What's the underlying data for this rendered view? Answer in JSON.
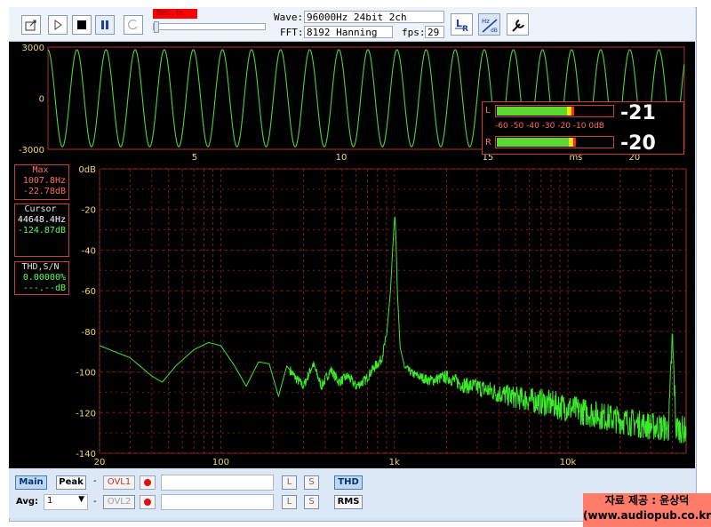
{
  "toolbar": {
    "rec_label": "Rec. In.",
    "wave_label": "Wave:",
    "wave_value": "96000Hz 24bit 2ch",
    "fft_label": "FFT:",
    "fft_value": "8192 Hanning",
    "fps_label": "fps:",
    "fps_value": "29",
    "icons": [
      "export-icon",
      "play-icon",
      "stop-icon",
      "pause-icon",
      "loop-icon",
      "lr-channel-icon",
      "hz-db-icon",
      "settings-wrench-icon"
    ]
  },
  "scope": {
    "y_ticks": [
      "3000",
      "0",
      "-3000"
    ],
    "x_ticks": [
      "5",
      "10",
      "15",
      "20"
    ],
    "x_unit": "ms",
    "waveform": {
      "amplitude": 2850,
      "frequency_hz": 1007.8,
      "duration_ms": 21.7
    },
    "color": "#4cd43a"
  },
  "meters": {
    "left": {
      "channel": "L",
      "value": "-21",
      "level_db": -21
    },
    "right": {
      "channel": "R",
      "value": "-20",
      "level_db": -20
    },
    "scale": "-60 -50 -40 -30 -20 -10 0dB"
  },
  "info": {
    "max_title": "Max",
    "max_freq": "1007.8Hz",
    "max_db": "-22.78dB",
    "cursor_title": "Cursor",
    "cursor_freq": "44648.4Hz",
    "cursor_db": "-124.87dB",
    "thd_title": "THD,S/N",
    "thd_value": "0.00000%",
    "sn_value": "---.--dB"
  },
  "spectrum": {
    "y_ticks": [
      "0dB",
      "-20",
      "-40",
      "-60",
      "-80",
      "-100",
      "-120",
      "-140"
    ],
    "x_ticks": [
      "20",
      "100",
      "1k",
      "10k"
    ],
    "color": "#3bea2a"
  },
  "chart_data": {
    "type": "line",
    "title": "",
    "xlabel": "",
    "ylabel": "",
    "xscale": "log",
    "xlim": [
      20,
      48000
    ],
    "ylim": [
      -140,
      0
    ],
    "grid": true,
    "series": [
      {
        "x": [
          20,
          30,
          40,
          46,
          55,
          70,
          85,
          100,
          120,
          140,
          165,
          190,
          215,
          240,
          270,
          300,
          340,
          380,
          430,
          480,
          540,
          600,
          680,
          760,
          840,
          900,
          950,
          980,
          1000,
          1008,
          1020,
          1040,
          1080,
          1150,
          1300,
          1600,
          2000,
          2500,
          3000,
          4000,
          5000,
          7000,
          10000,
          14000,
          20000,
          30000,
          38000,
          40000,
          42000,
          48000
        ],
        "y": [
          -87,
          -93,
          -102,
          -105,
          -97,
          -89,
          -85.5,
          -87,
          -97,
          -107,
          -95,
          -96,
          -112,
          -97,
          -103,
          -107,
          -96,
          -107,
          -99,
          -105,
          -102,
          -107,
          -104,
          -98,
          -94,
          -83,
          -60,
          -38,
          -26,
          -23,
          -32,
          -60,
          -88,
          -98,
          -101,
          -104,
          -102,
          -106,
          -107,
          -110,
          -112,
          -114,
          -117,
          -120,
          -123,
          -126,
          -127,
          -82,
          -127,
          -128
        ]
      }
    ]
  },
  "bottom": {
    "main_label": "Main",
    "peak_label": "Peak",
    "ovl1_label": "OVL1",
    "ovl2_label": "OVL2",
    "l_label": "L",
    "s_label": "S",
    "thd_label": "THD",
    "rms_label": "RMS",
    "avg_label": "Avg:",
    "avg_value": "1",
    "dash": "-"
  },
  "credit": {
    "line1": "자료 제공 : 윤상덕",
    "line2": "(www.audiopub.co.kr)"
  }
}
